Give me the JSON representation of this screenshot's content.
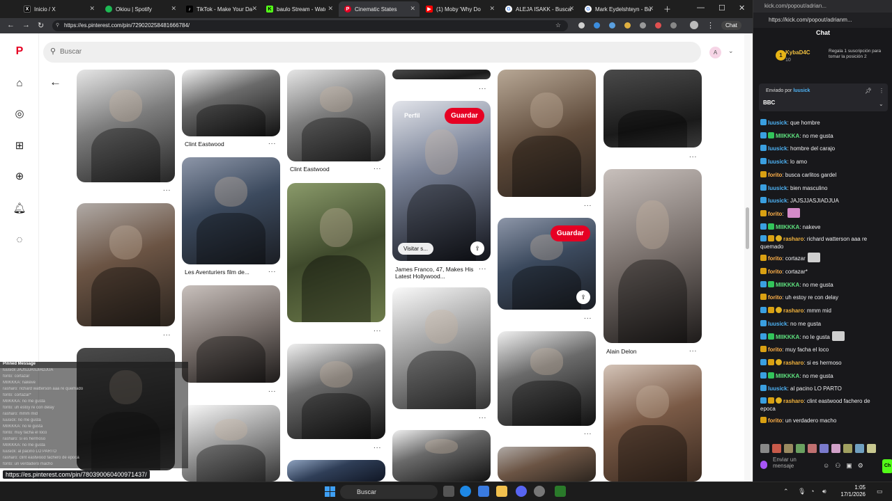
{
  "tabs": [
    {
      "label": "Inicio / X",
      "icon": "x-logo-icon",
      "active": false
    },
    {
      "label": "Okiou | Spotify",
      "icon": "spotify-icon",
      "active": false
    },
    {
      "label": "TikTok - Make Your Day",
      "icon": "tiktok-icon",
      "active": false
    },
    {
      "label": "baulo Stream - Watch L",
      "icon": "kick-icon",
      "active": false
    },
    {
      "label": "Cinematic States",
      "icon": "pinterest-icon",
      "active": true
    },
    {
      "label": "(1) Moby 'Why Do",
      "icon": "youtube-icon",
      "active": false
    },
    {
      "label": "ALEJA ISAKK - Buscar co",
      "icon": "google-icon",
      "active": false
    },
    {
      "label": "Mark Eydelshteyn - Bus",
      "icon": "google-icon",
      "active": false
    }
  ],
  "browser": {
    "url": "https://es.pinterest.com/pin/729020258481666784/",
    "chat_button": "Chat"
  },
  "pinterest": {
    "search_placeholder": "Buscar",
    "avatar_letter": "A",
    "save_label": "Guardar",
    "visit_label": "Visitar s...",
    "profile_label": "Perfil",
    "captions": {
      "clint1": "Clint Eastwood",
      "clint2": "Clint Eastwood",
      "delon1": "Les Aventuriers film de...",
      "franco": "James Franco, 47, Makes His Latest Hollywood...",
      "delon2": "Alain Delon"
    },
    "more_dots": "..."
  },
  "overlay": {
    "pinned_title": "Pinned Message",
    "status_url": "https://es.pinterest.com/pin/780390060400971437/",
    "lines": [
      "luusick JAJSJJASJIADJUA",
      "forito: cortazar",
      "MIIKKKA: nakeve",
      "rasharo: richard watterson aaa re quemado",
      "forito: cortazar*",
      "MIIKKKA: no me gusta",
      "forito: uh estoy re con delay",
      "rasharo: mmm mid",
      "luusick: no me gusta",
      "MIIKKKA: no le gusta",
      "forito: muy facha el loco",
      "rasharo: si es hermoso",
      "MIIKKKA: no me gusta",
      "luusick: al pacino LO PARTO",
      "rasharo: clint eastwood fachero de epoca",
      "forito: un verdadero macho"
    ]
  },
  "kick": {
    "url_top": "kick.com/popout/adrian...",
    "url_full": "https://kick.com/popout/adrianm...",
    "title": "Chat",
    "sub_user": "KybaD4C",
    "sub_count": "10",
    "sub_desc": "Regala 1 suscripción para tomar la posición 2",
    "pinned_by_label": "Enviado por",
    "pinned_by_user": "luusick",
    "pinned_message": "BBC",
    "input_placeholder": "Enviar un mensaje",
    "messages": [
      {
        "user": "luusick",
        "color": "blue",
        "badges": [
          "blue"
        ],
        "text": "que hombre"
      },
      {
        "user": "MIIKKKA",
        "color": "green",
        "badges": [
          "blue",
          "green"
        ],
        "text": "no me gusta"
      },
      {
        "user": "luusick",
        "color": "blue",
        "badges": [
          "blue"
        ],
        "text": "hombre del carajo"
      },
      {
        "user": "luusick",
        "color": "blue",
        "badges": [
          "blue"
        ],
        "text": "lo amo"
      },
      {
        "user": "forito",
        "color": "orange",
        "badges": [
          "gold"
        ],
        "text": "busca carlitos gardel"
      },
      {
        "user": "luusick",
        "color": "blue",
        "badges": [
          "blue"
        ],
        "text": "bien masculino"
      },
      {
        "user": "luusick",
        "color": "blue",
        "badges": [
          "blue"
        ],
        "text": "JAJSJJASJIADJUA"
      },
      {
        "user": "forito",
        "color": "orange",
        "badges": [
          "gold"
        ],
        "text": "",
        "emote": "pink"
      },
      {
        "user": "MIIKKKA",
        "color": "green",
        "badges": [
          "blue",
          "green"
        ],
        "text": "nakeve"
      },
      {
        "user": "rasharo",
        "color": "gold",
        "badges": [
          "blue",
          "gold",
          "circle"
        ],
        "text": "richard watterson aaa re quemado",
        "wrap": true
      },
      {
        "user": "forito",
        "color": "orange",
        "badges": [
          "gold"
        ],
        "text": "cortazar",
        "emote": "gray"
      },
      {
        "user": "forito",
        "color": "orange",
        "badges": [
          "gold"
        ],
        "text": "cortazar*"
      },
      {
        "user": "MIIKKKA",
        "color": "green",
        "badges": [
          "blue",
          "green"
        ],
        "text": "no me gusta"
      },
      {
        "user": "forito",
        "color": "orange",
        "badges": [
          "gold"
        ],
        "text": "uh estoy re con delay"
      },
      {
        "user": "rasharo",
        "color": "gold",
        "badges": [
          "blue",
          "gold",
          "circle"
        ],
        "text": "mmm mid"
      },
      {
        "user": "luusick",
        "color": "blue",
        "badges": [
          "blue"
        ],
        "text": "no me gusta"
      },
      {
        "user": "MIIKKKA",
        "color": "green",
        "badges": [
          "blue",
          "green"
        ],
        "text": "no le gusta",
        "emote": "gray"
      },
      {
        "user": "forito",
        "color": "orange",
        "badges": [
          "gold"
        ],
        "text": "muy facha el loco"
      },
      {
        "user": "rasharo",
        "color": "gold",
        "badges": [
          "blue",
          "gold",
          "circle"
        ],
        "text": "si es hermoso"
      },
      {
        "user": "MIIKKKA",
        "color": "green",
        "badges": [
          "blue",
          "green"
        ],
        "text": "no me gusta"
      },
      {
        "user": "luusick",
        "color": "blue",
        "badges": [
          "blue"
        ],
        "text": "al pacino LO PARTO"
      },
      {
        "user": "rasharo",
        "color": "gold",
        "badges": [
          "blue",
          "gold",
          "circle"
        ],
        "text": "clint eastwood fachero de epoca",
        "wrap": true
      },
      {
        "user": "forito",
        "color": "orange",
        "badges": [
          "gold"
        ],
        "text": "un verdadero macho"
      }
    ]
  },
  "taskbar": {
    "search_label": "Buscar",
    "time": "1:05",
    "date": "17/1/2026"
  },
  "colors": {
    "pinterest_red": "#e60023",
    "kick_green": "#53fc18",
    "chat_bg": "#18181b"
  }
}
